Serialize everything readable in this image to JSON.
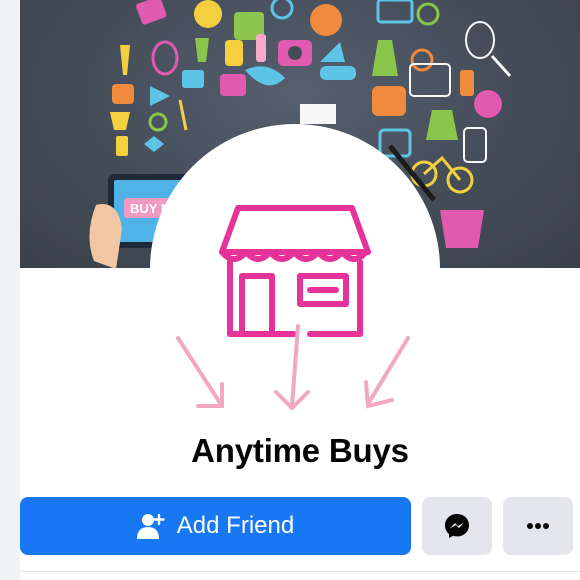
{
  "cover": {
    "buy_now_text": "BUY NOW"
  },
  "avatar": {
    "icon": "store-icon",
    "accent_color": "#e6339a",
    "arrow_color": "#f2a7c3"
  },
  "profile": {
    "name": "Anytime Buys"
  },
  "actions": {
    "add_friend_label": "Add Friend",
    "add_friend_icon": "add-user-icon",
    "messenger_icon": "messenger-icon",
    "more_icon": "more-icon",
    "primary_color": "#1877f2",
    "secondary_color": "#e4e6eb"
  }
}
